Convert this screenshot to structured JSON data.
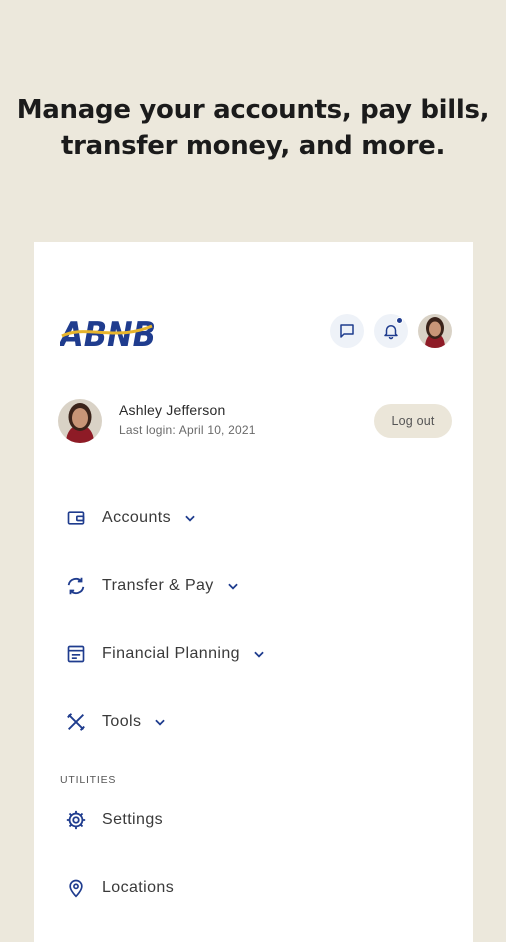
{
  "headline": {
    "line1": "Manage your accounts, pay bills,",
    "line2": "transfer money, and more."
  },
  "brand": {
    "logo_text": "ABNB",
    "primary_color": "#1f3c8e",
    "accent_color": "#e7b52c"
  },
  "header": {
    "icons": [
      "chat-icon",
      "bell-icon",
      "avatar"
    ],
    "has_notification": true
  },
  "profile": {
    "name": "Ashley Jefferson",
    "last_login": "Last login: April 10, 2021",
    "logout_label": "Log out"
  },
  "menu": [
    {
      "label": "Accounts",
      "icon": "wallet-icon",
      "expandable": true
    },
    {
      "label": "Transfer & Pay",
      "icon": "transfer-icon",
      "expandable": true
    },
    {
      "label": "Financial Planning",
      "icon": "planning-icon",
      "expandable": true
    },
    {
      "label": "Tools",
      "icon": "tools-icon",
      "expandable": true
    }
  ],
  "utilities": {
    "section_label": "UTILITIES",
    "items": [
      {
        "label": "Settings",
        "icon": "gear-icon"
      },
      {
        "label": "Locations",
        "icon": "location-pin-icon"
      }
    ]
  }
}
